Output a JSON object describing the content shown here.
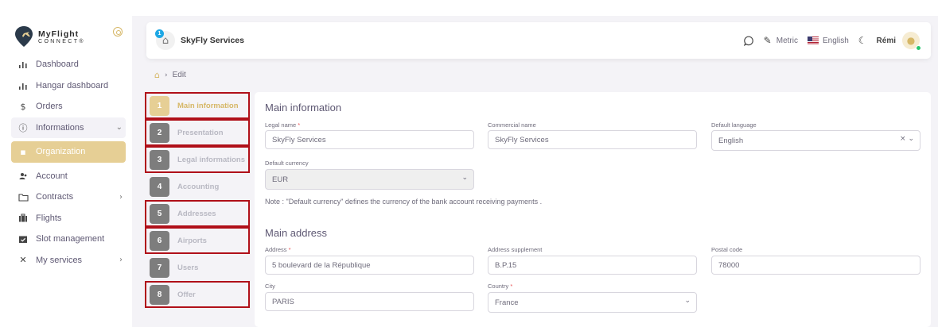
{
  "brand": {
    "name_line1": "MyFlight",
    "name_line2": "CONNECT®"
  },
  "sidebar": {
    "items": [
      {
        "label": "Dashboard",
        "icon": "bar-chart-icon"
      },
      {
        "label": "Hangar dashboard",
        "icon": "bar-chart-icon"
      },
      {
        "label": "Orders",
        "icon": "dollar-icon"
      },
      {
        "label": "Informations",
        "icon": "info-icon"
      },
      {
        "label": "Organization",
        "icon": "building-icon"
      },
      {
        "label": "Account",
        "icon": "users-icon"
      },
      {
        "label": "Contracts",
        "icon": "folder-icon"
      },
      {
        "label": "Flights",
        "icon": "briefcase-icon"
      },
      {
        "label": "Slot management",
        "icon": "calendar-check-icon"
      },
      {
        "label": "My services",
        "icon": "tools-icon"
      }
    ]
  },
  "topbar": {
    "company_name": "SkyFly Services",
    "company_badge": "1",
    "units": "Metric",
    "language": "English",
    "user": "Rémi"
  },
  "breadcrumb": {
    "current": "Edit"
  },
  "steps": [
    {
      "num": "1",
      "label": "Main information"
    },
    {
      "num": "2",
      "label": "Presentation"
    },
    {
      "num": "3",
      "label": "Legal informations"
    },
    {
      "num": "4",
      "label": "Accounting"
    },
    {
      "num": "5",
      "label": "Addresses"
    },
    {
      "num": "6",
      "label": "Airports"
    },
    {
      "num": "7",
      "label": "Users"
    },
    {
      "num": "8",
      "label": "Offer"
    }
  ],
  "form": {
    "main_info_title": "Main information",
    "legal_name": {
      "label": "Legal name",
      "value": "SkyFly Services"
    },
    "commercial_name": {
      "label": "Commercial name",
      "value": "SkyFly Services"
    },
    "default_language": {
      "label": "Default language",
      "value": "English"
    },
    "default_currency": {
      "label": "Default currency",
      "value": "EUR"
    },
    "note": "Note : \"Default currency\" defines the currency of the bank account receiving payments .",
    "main_address_title": "Main address",
    "address": {
      "label": "Address",
      "value": "5 boulevard de la République"
    },
    "address_supplement": {
      "label": "Address supplement",
      "value": "B.P.15"
    },
    "postal_code": {
      "label": "Postal code",
      "value": "78000"
    },
    "city": {
      "label": "City",
      "value": "PARIS"
    },
    "country": {
      "label": "Country",
      "value": "France"
    }
  },
  "colors": {
    "accent": "#d6b766",
    "highlight": "#b01019",
    "background": "#f4f3f7"
  }
}
